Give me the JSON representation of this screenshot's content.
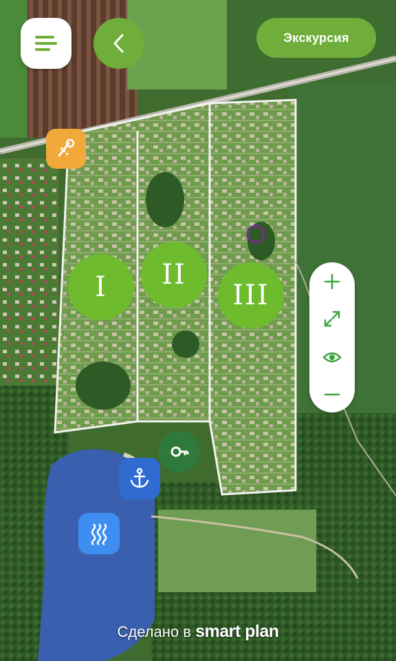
{
  "header": {
    "menu_icon": "hamburger-icon",
    "back_icon": "chevron-left-icon",
    "tour_label": "Экскурсия"
  },
  "sectors": [
    {
      "label": "I"
    },
    {
      "label": "II"
    },
    {
      "label": "III"
    }
  ],
  "pois": [
    {
      "icon": "shower-icon",
      "color": "#f2a93b"
    },
    {
      "icon": "key-icon",
      "color": "#2f7a3a"
    },
    {
      "icon": "anchor-icon",
      "color": "#2f6bd1"
    },
    {
      "icon": "water-waves-icon",
      "color": "#3d8ef0"
    }
  ],
  "zoom_controls": {
    "zoom_in_icon": "plus-icon",
    "fullscreen_icon": "expand-icon",
    "view_icon": "eye-icon",
    "zoom_out_icon": "minus-icon"
  },
  "footer": {
    "prefix": "Сделано в",
    "brand": "smart plan"
  },
  "colors": {
    "accent": "#6fae3a",
    "sector": "#6fbb2e",
    "map_green": "#4b7d37",
    "lake": "#3a5fae"
  }
}
